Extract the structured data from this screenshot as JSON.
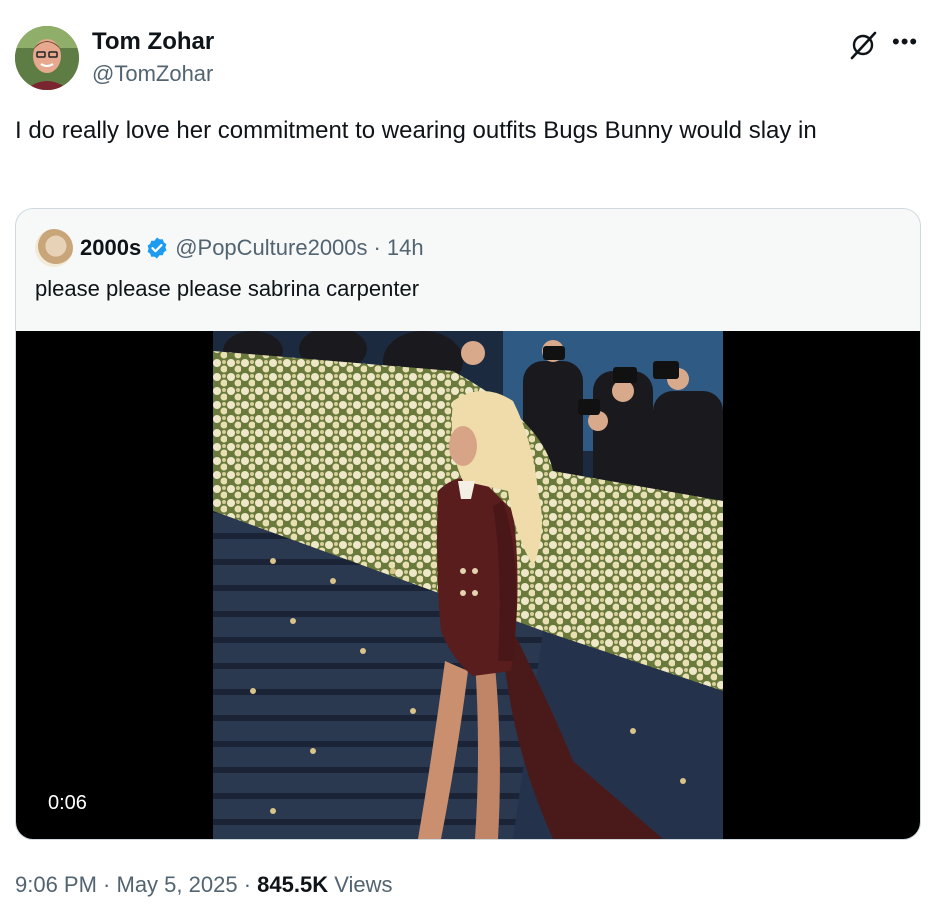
{
  "tweet": {
    "author": {
      "name": "Tom Zohar",
      "handle": "@TomZohar"
    },
    "text": "I do really love her commitment to wearing outfits Bugs Bunny would slay in",
    "icons": {
      "grok": "grok-icon",
      "more": "more-options-icon"
    }
  },
  "quote": {
    "author_name": "2000s",
    "handle": "@PopCulture2000s",
    "separator": "·",
    "time": "14h",
    "text": "please please please sabrina carpenter",
    "verified_color": "#1d9bf0",
    "video": {
      "duration": "0:06"
    }
  },
  "meta": {
    "time": "9:06 PM",
    "sep1": " · ",
    "date": "May 5, 2025",
    "sep2": " · ",
    "views_count": "845.5K",
    "views_label": " Views"
  },
  "colors": {
    "text": "#0f1419",
    "secondary": "#536471",
    "border": "#cfd9de",
    "accent": "#1d9bf0"
  }
}
